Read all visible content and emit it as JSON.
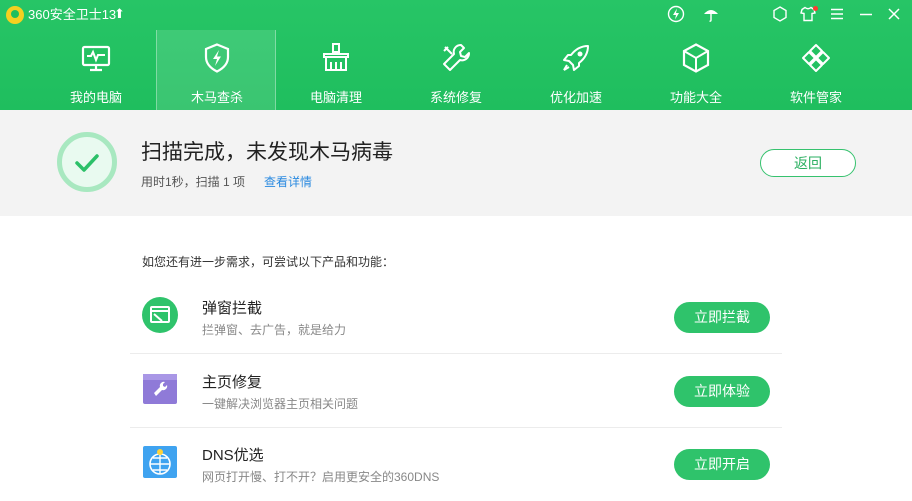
{
  "window": {
    "title": "360安全卫士13",
    "update_icon": "up-arrow-icon",
    "titlebar_icons": [
      "flash-icon",
      "umbrella-icon",
      "settings-icon",
      "skin-icon",
      "menu-icon",
      "minimize-icon",
      "close-icon"
    ]
  },
  "nav": {
    "items": [
      {
        "label": "我的电脑",
        "icon": "monitor-icon"
      },
      {
        "label": "木马查杀",
        "icon": "shield-bolt-icon",
        "active": true
      },
      {
        "label": "电脑清理",
        "icon": "broom-icon"
      },
      {
        "label": "系统修复",
        "icon": "wrench-icon"
      },
      {
        "label": "优化加速",
        "icon": "rocket-icon"
      },
      {
        "label": "功能大全",
        "icon": "cube-icon"
      },
      {
        "label": "软件管家",
        "icon": "apps-icon"
      }
    ]
  },
  "status": {
    "title": "扫描完成，未发现木马病毒",
    "subtitle": "用时1秒，扫描 1 项",
    "details_link": "查看详情",
    "back_button": "返回"
  },
  "suggestions": {
    "hint": "如您还有进一步需求，可尝试以下产品和功能：",
    "items": [
      {
        "title": "弹窗拦截",
        "desc": "拦弹窗、去广告，就是给力",
        "button": "立即拦截",
        "icon": "popup-block-icon"
      },
      {
        "title": "主页修复",
        "desc": "一键解决浏览器主页相关问题",
        "button": "立即体验",
        "icon": "homepage-repair-icon"
      },
      {
        "title": "DNS优选",
        "desc": "网页打开慢、打不开？启用更安全的360DNS",
        "button": "立即开启",
        "icon": "dns-globe-icon"
      }
    ]
  },
  "colors": {
    "header_green": "#1fbe5e",
    "button_green": "#2fc36b",
    "link_blue": "#2a8ae0",
    "status_bg": "#f3f3f3"
  }
}
